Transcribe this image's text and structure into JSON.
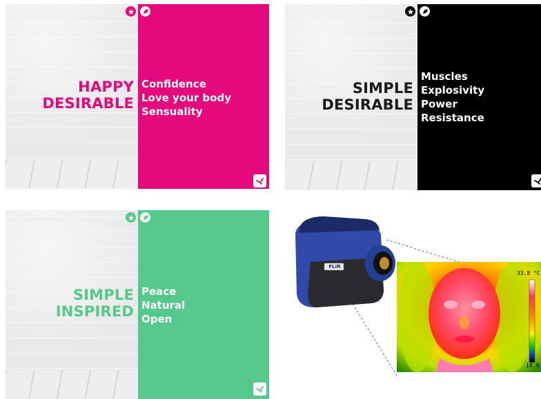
{
  "panels": [
    {
      "id": "happy",
      "accent": "#e5087c",
      "left_words": [
        "HAPPY",
        "DESIRABLE"
      ],
      "right_words": [
        "Confidence",
        "Love your body",
        "Sensuality"
      ]
    },
    {
      "id": "simple-black",
      "accent": "#000000",
      "left_words": [
        "SIMPLE",
        "DESIRABLE"
      ],
      "right_words": [
        "Muscles",
        "Explosivity",
        "Power",
        "Resistance"
      ]
    },
    {
      "id": "simple-green",
      "accent": "#55c98c",
      "left_words": [
        "SIMPLE",
        "INSPIRED"
      ],
      "right_words": [
        "Peace",
        "Natural",
        "Open"
      ]
    }
  ],
  "icons": {
    "badge_left": "star-icon",
    "badge_right": "feather-icon",
    "corner_logo": "bird-logo-icon"
  },
  "thermal": {
    "camera_brand": "FLIR",
    "scale_max": "33.8 °C",
    "scale_min": "18.9"
  }
}
